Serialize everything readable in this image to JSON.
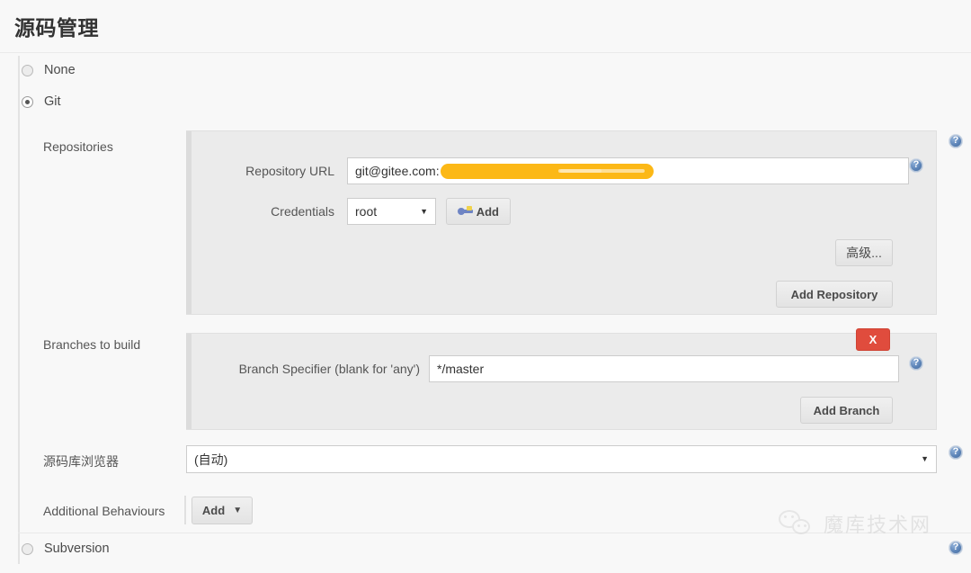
{
  "page": {
    "title": "源码管理"
  },
  "scm_options": [
    {
      "label": "None",
      "checked": false
    },
    {
      "label": "Git",
      "checked": true
    },
    {
      "label": "Subversion",
      "checked": false
    }
  ],
  "repositories": {
    "label": "Repositories",
    "repository_url": {
      "label": "Repository URL",
      "value": "git@gitee.com:",
      "redacted": true
    },
    "credentials": {
      "label": "Credentials",
      "selected": "root",
      "options": [
        "root"
      ],
      "add_button": {
        "label": "Add",
        "icon": "key-icon"
      }
    },
    "advanced_button": "高级...",
    "add_repository_button": "Add Repository"
  },
  "branches": {
    "label": "Branches to build",
    "branch_specifier": {
      "label": "Branch Specifier (blank for 'any')",
      "value": "*/master"
    },
    "delete_button": "X",
    "add_branch_button": "Add Branch"
  },
  "repository_browser": {
    "label": "源码库浏览器",
    "selected": "(自动)",
    "options": [
      "(自动)"
    ]
  },
  "additional_behaviours": {
    "label": "Additional Behaviours",
    "add_button": "Add"
  },
  "help_icon": "?",
  "watermark": {
    "text": "魔库技术网",
    "icon": "wechat-icon"
  }
}
